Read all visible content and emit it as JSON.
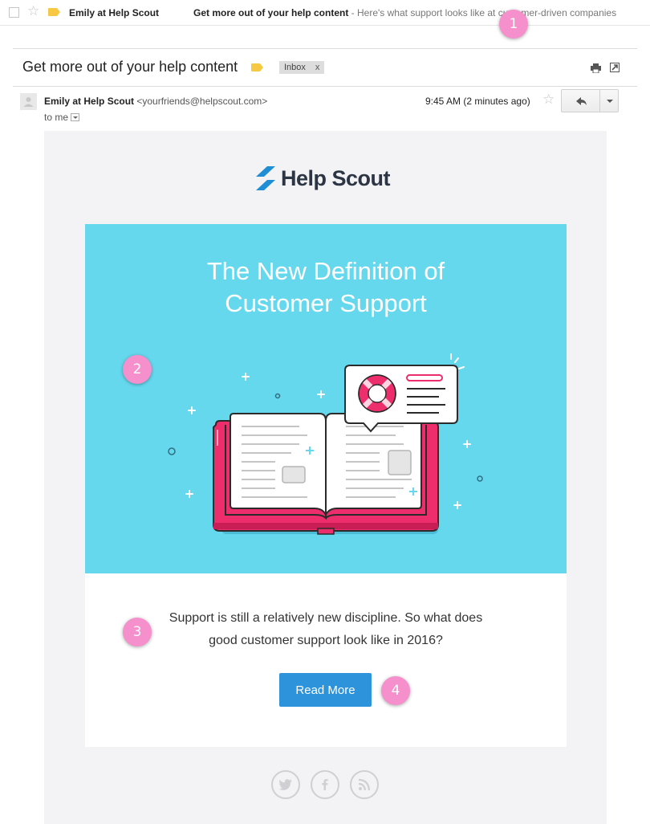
{
  "inbox_row": {
    "sender": "Emily at Help Scout",
    "subject": "Get more out of your help content",
    "snippet": " - Here's what support looks like at customer-driven companies"
  },
  "header": {
    "subject": "Get more out of your help content",
    "label_chip": "Inbox",
    "label_remove": "x"
  },
  "message": {
    "sender_name": "Emily at Help Scout",
    "sender_email": "<yourfriends@helpscout.com>",
    "to": "to me",
    "time": "9:45 AM (2 minutes ago)"
  },
  "email": {
    "brand": "Help Scout",
    "hero_title_line1": "The New Definition of",
    "hero_title_line2": "Customer Support",
    "body_line1": "Support is still a relatively new discipline. So what does",
    "body_line2": "good customer support look like in 2016?",
    "cta_label": "Read More"
  },
  "annotations": [
    "1",
    "2",
    "3",
    "4"
  ],
  "colors": {
    "hero_bg": "#66d8ee",
    "cta": "#2d94dc",
    "book_cover": "#ee2d6c",
    "label_tag": "#f6c844",
    "marker": "#f590cc"
  }
}
